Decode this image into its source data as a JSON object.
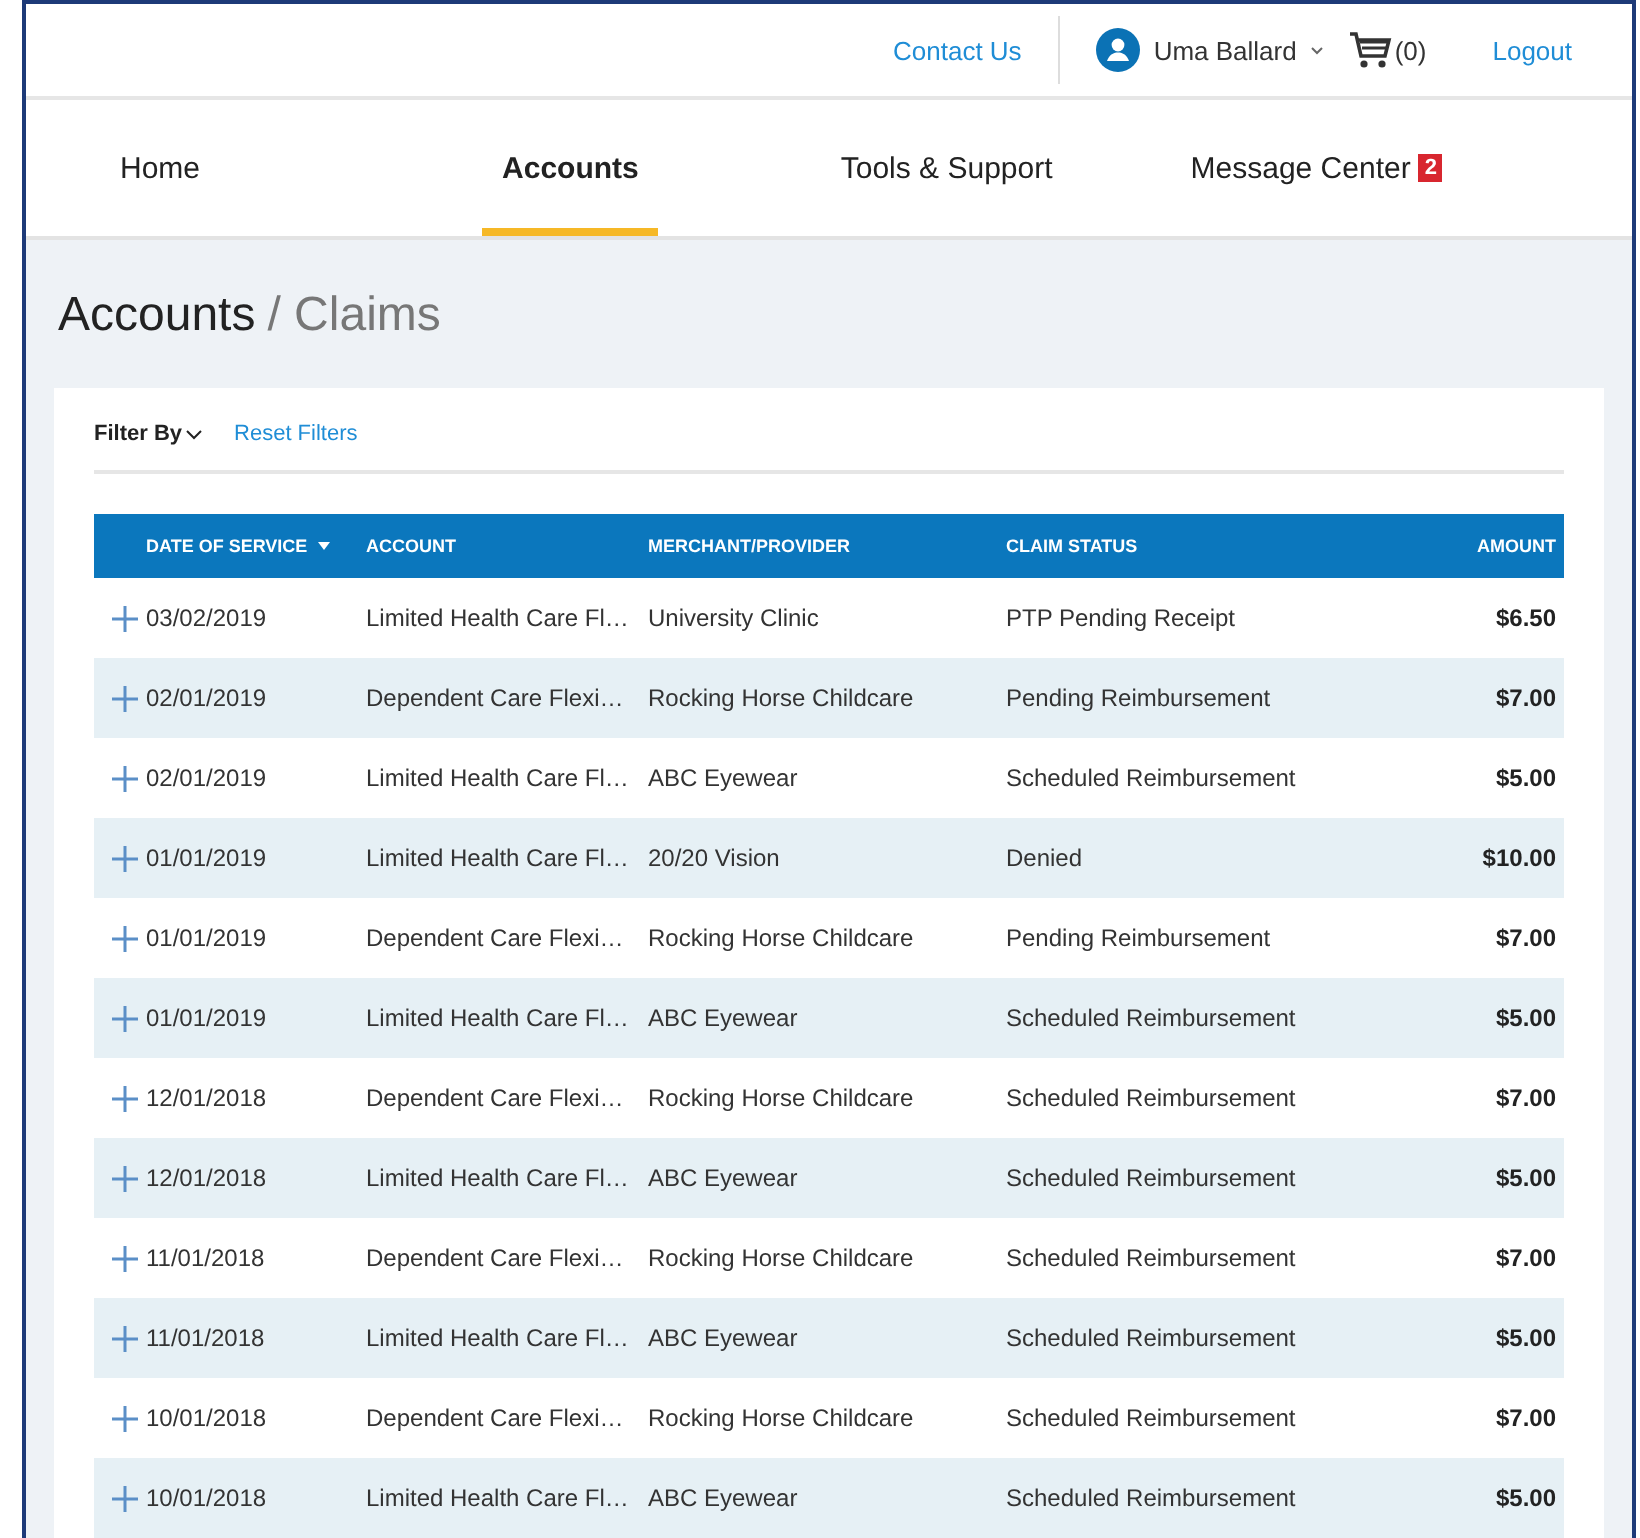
{
  "top_bar": {
    "contact_link": "Contact Us",
    "user_name": "Uma Ballard",
    "cart_count": "(0)",
    "logout_link": "Logout"
  },
  "nav_tabs": [
    {
      "label": "Home",
      "selected": false
    },
    {
      "label": "Accounts",
      "selected": true
    },
    {
      "label": "Tools & Support",
      "selected": false
    },
    {
      "label": "Message Center",
      "selected": false,
      "badge": "2"
    }
  ],
  "breadcrumb": {
    "parent": "Accounts",
    "current": "/ Claims"
  },
  "filters": {
    "filter_label": "Filter By",
    "reset_link": "Reset Filters"
  },
  "table": {
    "columns": [
      {
        "label": "DATE OF SERVICE",
        "sorted": true
      },
      {
        "label": "ACCOUNT",
        "sorted": false
      },
      {
        "label": "MERCHANT/PROVIDER",
        "sorted": false
      },
      {
        "label": "CLAIM STATUS",
        "sorted": false
      },
      {
        "label": "AMOUNT",
        "sorted": false
      }
    ],
    "rows": [
      {
        "date": "03/02/2019",
        "account": "Limited Health Care Fl…",
        "merchant": "University Clinic",
        "status": "PTP Pending Receipt",
        "amount": "$6.50"
      },
      {
        "date": "02/01/2019",
        "account": "Dependent Care Flexi…",
        "merchant": "Rocking Horse Childcare",
        "status": "Pending Reimbursement",
        "amount": "$7.00"
      },
      {
        "date": "02/01/2019",
        "account": "Limited Health Care Fl…",
        "merchant": "ABC Eyewear",
        "status": "Scheduled Reimbursement",
        "amount": "$5.00"
      },
      {
        "date": "01/01/2019",
        "account": "Limited Health Care Fl…",
        "merchant": "20/20 Vision",
        "status": "Denied",
        "amount": "$10.00"
      },
      {
        "date": "01/01/2019",
        "account": "Dependent Care Flexi…",
        "merchant": "Rocking Horse Childcare",
        "status": "Pending Reimbursement",
        "amount": "$7.00"
      },
      {
        "date": "01/01/2019",
        "account": "Limited Health Care Fl…",
        "merchant": "ABC Eyewear",
        "status": "Scheduled Reimbursement",
        "amount": "$5.00"
      },
      {
        "date": "12/01/2018",
        "account": "Dependent Care Flexi…",
        "merchant": "Rocking Horse Childcare",
        "status": "Scheduled Reimbursement",
        "amount": "$7.00"
      },
      {
        "date": "12/01/2018",
        "account": "Limited Health Care Fl…",
        "merchant": "ABC Eyewear",
        "status": "Scheduled Reimbursement",
        "amount": "$5.00"
      },
      {
        "date": "11/01/2018",
        "account": "Dependent Care Flexi…",
        "merchant": "Rocking Horse Childcare",
        "status": "Scheduled Reimbursement",
        "amount": "$7.00"
      },
      {
        "date": "11/01/2018",
        "account": "Limited Health Care Fl…",
        "merchant": "ABC Eyewear",
        "status": "Scheduled Reimbursement",
        "amount": "$5.00"
      },
      {
        "date": "10/01/2018",
        "account": "Dependent Care Flexi…",
        "merchant": "Rocking Horse Childcare",
        "status": "Scheduled Reimbursement",
        "amount": "$7.00"
      },
      {
        "date": "10/01/2018",
        "account": "Limited Health Care Fl…",
        "merchant": "ABC Eyewear",
        "status": "Scheduled Reimbursement",
        "amount": "$5.00"
      }
    ]
  }
}
